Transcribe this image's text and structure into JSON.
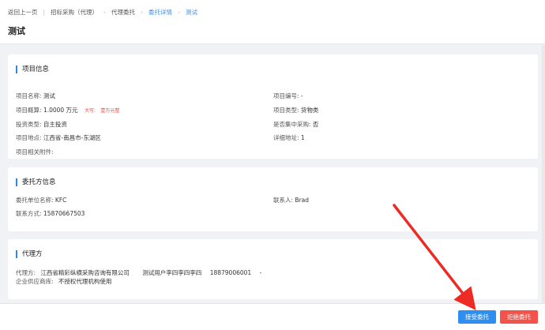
{
  "breadcrumb": {
    "back": "返回上一页",
    "items": [
      "招标采购（代理）",
      "代理委托",
      "委托详情",
      "测试"
    ]
  },
  "page_title": "测试",
  "project_info": {
    "title": "项目信息",
    "name_label": "项目名称:",
    "name_value": "测试",
    "number_label": "项目编号:",
    "number_value": "-",
    "budget_label": "项目概算:",
    "budget_value": "1.0000 万元",
    "budget_caps_label": "大写:",
    "budget_caps_value": "壹万元整",
    "type_label": "项目类型:",
    "type_value": "货物类",
    "invest_label": "投资类型:",
    "invest_value": "自主投资",
    "central_label": "是否集中采购:",
    "central_value": "否",
    "location_label": "项目地点:",
    "location_value": "江西省-南昌市-东湖区",
    "address_label": "详细地址:",
    "address_value": "1",
    "attachments_label": "项目相关附件:"
  },
  "client_info": {
    "title": "委托方信息",
    "org_label": "委托单位名称:",
    "org_value": "KFC",
    "contact_label": "联系人:",
    "contact_value": "Brad",
    "phone_label": "联系方式:",
    "phone_value": "15870667503"
  },
  "agent_info": {
    "title": "代理方",
    "agent_label": "代理方:",
    "agent_value": "江西省精彩纵横采购咨询有限公司",
    "user_value": "测试用户李四李四李四",
    "phone_value": "18879006001",
    "dash": "-",
    "library_label": "企业供应商库:",
    "library_value": "不授权代理机构使用"
  },
  "actions": {
    "accept": "接受委托",
    "reject": "拒绝委托"
  },
  "colors": {
    "primary": "#2f8ff0",
    "danger": "#f2544b",
    "annotation_arrow": "#ee2a24"
  }
}
